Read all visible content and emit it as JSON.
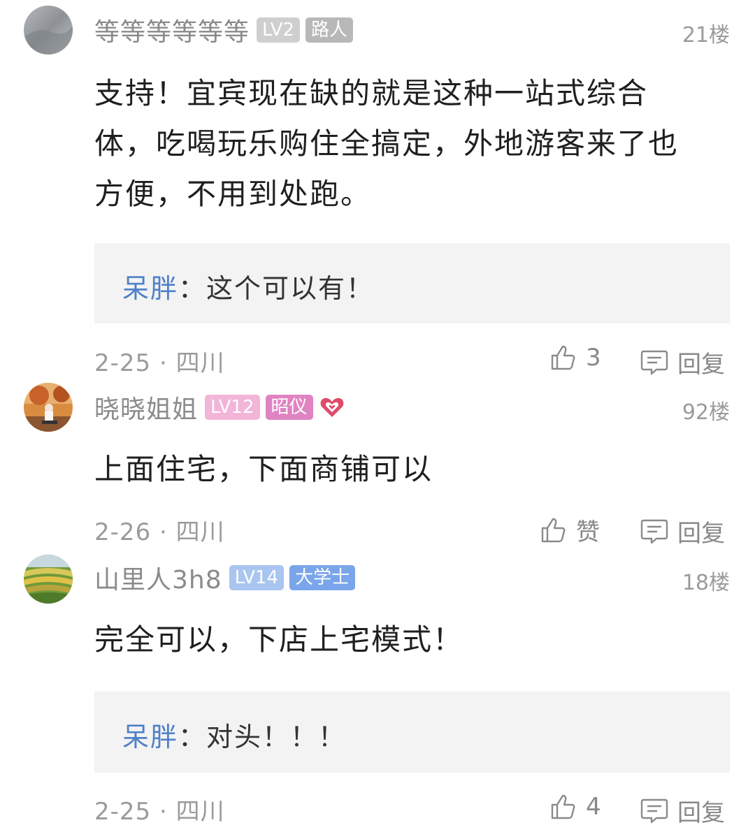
{
  "comments": [
    {
      "username": "等等等等等等",
      "level": "LV2",
      "title": "路人",
      "floor": "21楼",
      "content": "支持！宜宾现在缺的就是这种一站式综合体，吃喝玩乐购住全搞定，外地游客来了也方便，不用到处跑。",
      "reply": {
        "name": "呆胖",
        "sep": "：",
        "text": "这个可以有！"
      },
      "date": "2-25",
      "dot": "·",
      "location": "四川",
      "like_label": "3",
      "reply_label": "回复",
      "level_color": "#cfcfcf",
      "title_color": "#b8b8b8"
    },
    {
      "username": "晓晓姐姐",
      "level": "LV12",
      "title": "昭仪",
      "floor": "92楼",
      "content": "上面住宅，下面商铺可以",
      "date": "2-26",
      "dot": "·",
      "location": "四川",
      "like_label": "赞",
      "reply_label": "回复",
      "level_color": "#f2b5d8",
      "title_color": "#e083c2"
    },
    {
      "username": "山里人3h8",
      "level": "LV14",
      "title": "大学士",
      "floor": "18楼",
      "content": "完全可以，下店上宅模式！",
      "reply": {
        "name": "呆胖",
        "sep": "：",
        "text": "对头！！！"
      },
      "date": "2-25",
      "dot": "·",
      "location": "四川",
      "like_label": "4",
      "reply_label": "回复",
      "level_color": "#a9c5f0",
      "title_color": "#7aa5ea"
    }
  ],
  "icons": {
    "like": "thumbs-up-icon",
    "reply": "comment-bubble-icon",
    "heart": "heart-icon"
  }
}
